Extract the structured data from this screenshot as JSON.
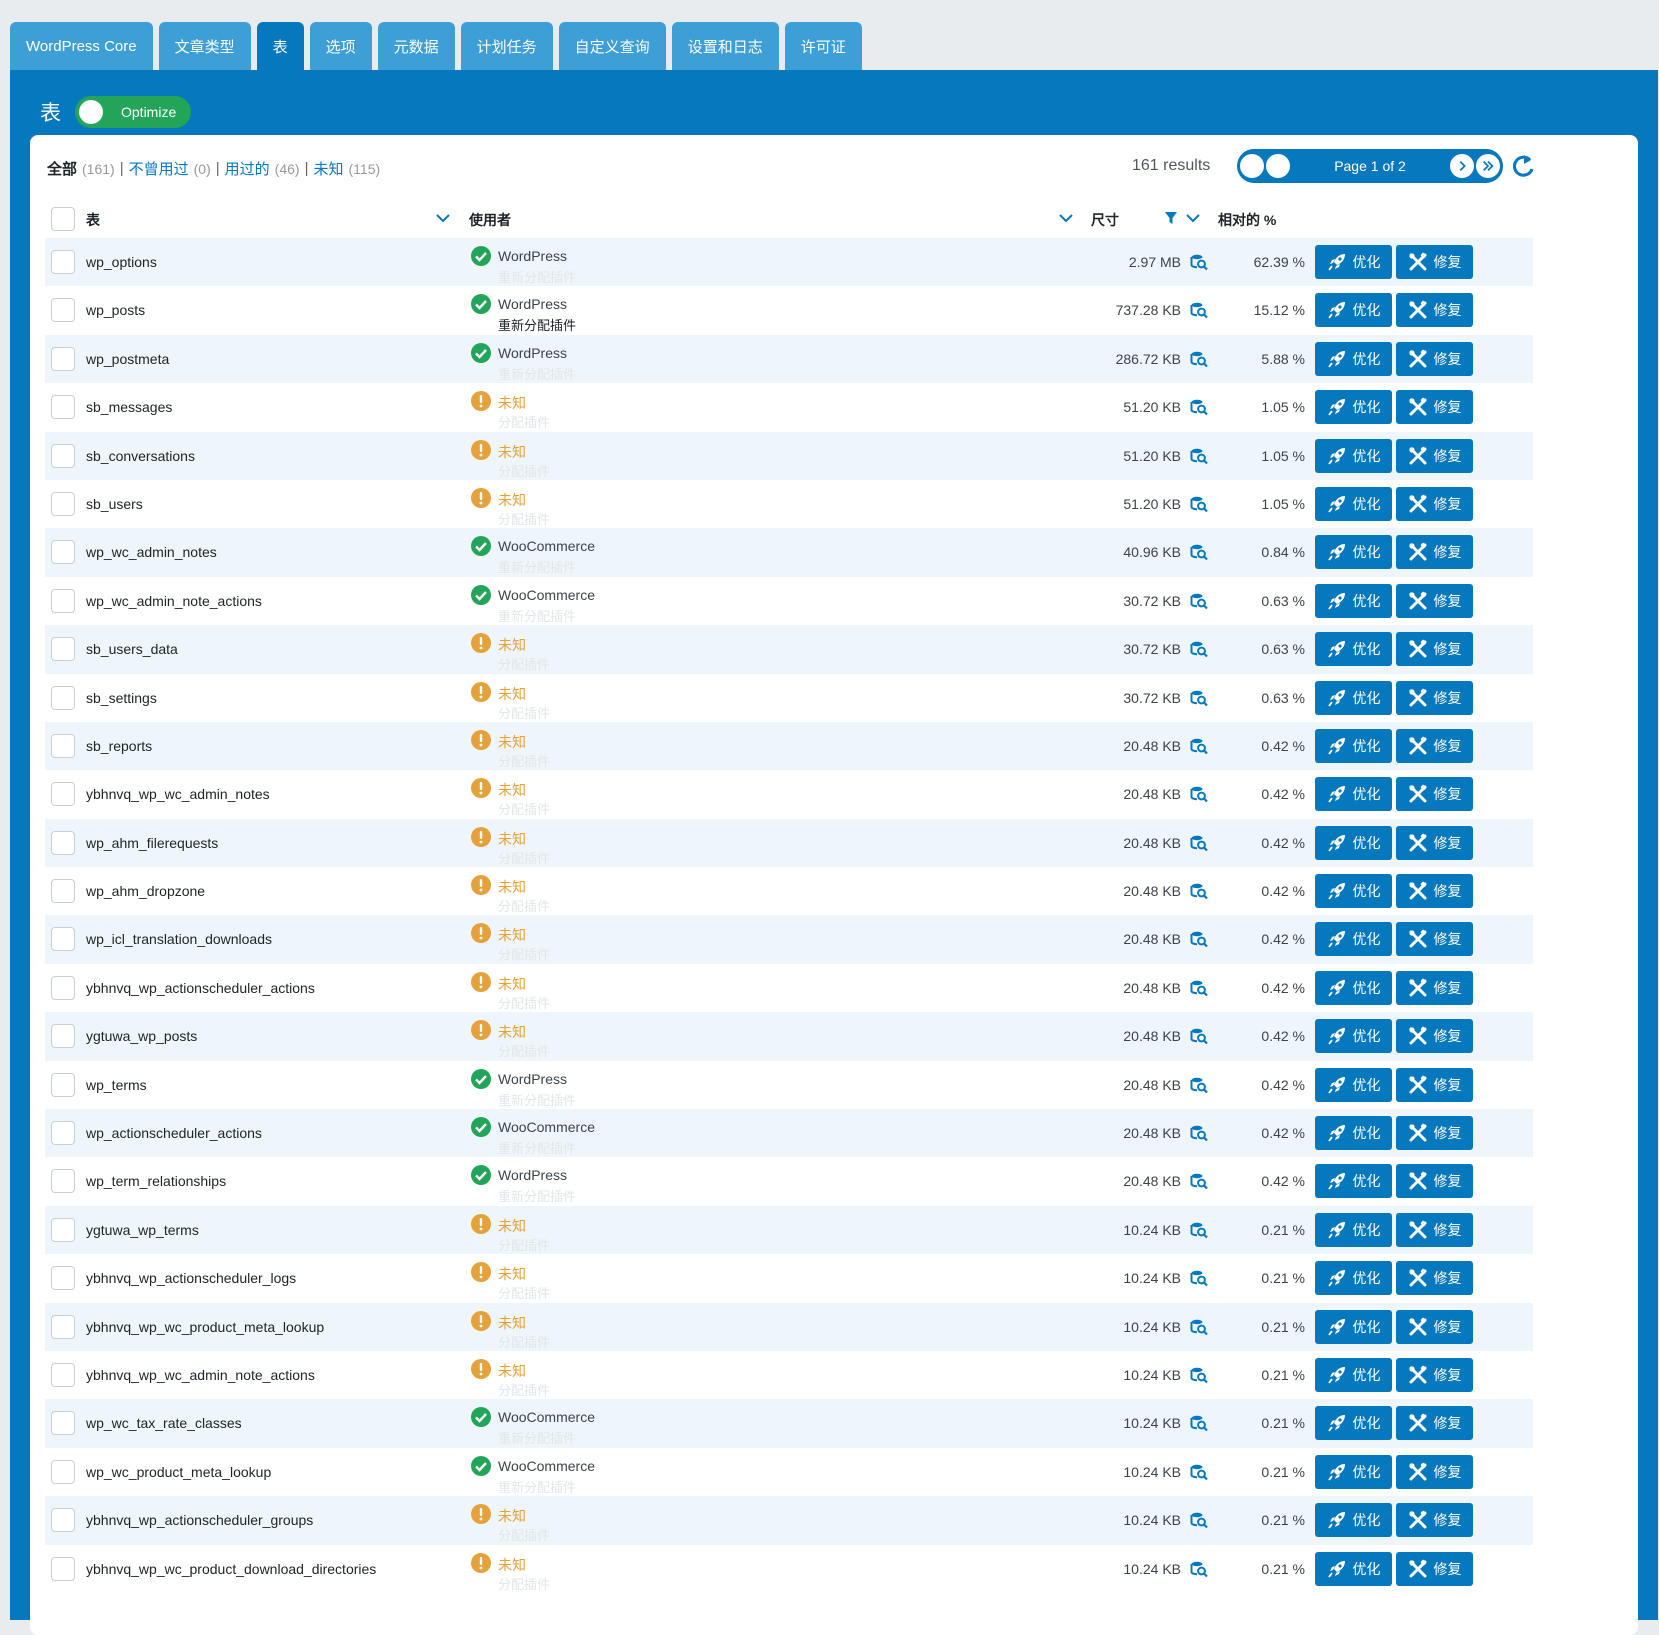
{
  "tabs": [
    "WordPress Core",
    "文章类型",
    "表",
    "选项",
    "元数据",
    "计划任务",
    "自定义查询",
    "设置和日志",
    "许可证"
  ],
  "active_tab": 2,
  "panel": {
    "title": "表",
    "toggle_label": "Optimize"
  },
  "filters": [
    {
      "label": "全部",
      "count": "(161)"
    },
    {
      "label": "不曾用过",
      "count": "(0)"
    },
    {
      "label": "用过的",
      "count": "(46)"
    },
    {
      "label": "未知",
      "count": "(115)"
    }
  ],
  "filter_separator": "|",
  "results": "161 results",
  "pager": {
    "label": "Page 1 of 2"
  },
  "columns": {
    "table": "表",
    "used_by": "使用者",
    "size": "尺寸",
    "relative": "相对的 %"
  },
  "buttons": {
    "optimize": "优化",
    "repair": "修复"
  },
  "colors": {
    "primary": "#0678be",
    "tab": "#3e9fd6",
    "ok": "#22a559",
    "unknown": "#e5a13a"
  },
  "rows": [
    {
      "name": "wp_options",
      "status": "ok",
      "owner": "WordPress",
      "sub": "重新分配插件",
      "sub_visible": false,
      "size": "2.97 MB",
      "pct": "62.39 %"
    },
    {
      "name": "wp_posts",
      "status": "ok",
      "owner": "WordPress",
      "sub": "重新分配插件",
      "sub_visible": true,
      "size": "737.28 KB",
      "pct": "15.12 %"
    },
    {
      "name": "wp_postmeta",
      "status": "ok",
      "owner": "WordPress",
      "sub": "重新分配插件",
      "sub_visible": false,
      "size": "286.72 KB",
      "pct": "5.88 %"
    },
    {
      "name": "sb_messages",
      "status": "unknown",
      "owner": "未知",
      "sub": "分配插件",
      "sub_visible": false,
      "size": "51.20 KB",
      "pct": "1.05 %"
    },
    {
      "name": "sb_conversations",
      "status": "unknown",
      "owner": "未知",
      "sub": "分配插件",
      "sub_visible": false,
      "size": "51.20 KB",
      "pct": "1.05 %"
    },
    {
      "name": "sb_users",
      "status": "unknown",
      "owner": "未知",
      "sub": "分配插件",
      "sub_visible": false,
      "size": "51.20 KB",
      "pct": "1.05 %"
    },
    {
      "name": "wp_wc_admin_notes",
      "status": "ok",
      "owner": "WooCommerce",
      "sub": "重新分配插件",
      "sub_visible": false,
      "size": "40.96 KB",
      "pct": "0.84 %"
    },
    {
      "name": "wp_wc_admin_note_actions",
      "status": "ok",
      "owner": "WooCommerce",
      "sub": "重新分配插件",
      "sub_visible": false,
      "size": "30.72 KB",
      "pct": "0.63 %"
    },
    {
      "name": "sb_users_data",
      "status": "unknown",
      "owner": "未知",
      "sub": "分配插件",
      "sub_visible": false,
      "size": "30.72 KB",
      "pct": "0.63 %"
    },
    {
      "name": "sb_settings",
      "status": "unknown",
      "owner": "未知",
      "sub": "分配插件",
      "sub_visible": false,
      "size": "30.72 KB",
      "pct": "0.63 %"
    },
    {
      "name": "sb_reports",
      "status": "unknown",
      "owner": "未知",
      "sub": "分配插件",
      "sub_visible": false,
      "size": "20.48 KB",
      "pct": "0.42 %"
    },
    {
      "name": "ybhnvq_wp_wc_admin_notes",
      "status": "unknown",
      "owner": "未知",
      "sub": "分配插件",
      "sub_visible": false,
      "size": "20.48 KB",
      "pct": "0.42 %"
    },
    {
      "name": "wp_ahm_filerequests",
      "status": "unknown",
      "owner": "未知",
      "sub": "分配插件",
      "sub_visible": false,
      "size": "20.48 KB",
      "pct": "0.42 %"
    },
    {
      "name": "wp_ahm_dropzone",
      "status": "unknown",
      "owner": "未知",
      "sub": "分配插件",
      "sub_visible": false,
      "size": "20.48 KB",
      "pct": "0.42 %"
    },
    {
      "name": "wp_icl_translation_downloads",
      "status": "unknown",
      "owner": "未知",
      "sub": "分配插件",
      "sub_visible": false,
      "size": "20.48 KB",
      "pct": "0.42 %"
    },
    {
      "name": "ybhnvq_wp_actionscheduler_actions",
      "status": "unknown",
      "owner": "未知",
      "sub": "分配插件",
      "sub_visible": false,
      "size": "20.48 KB",
      "pct": "0.42 %"
    },
    {
      "name": "ygtuwa_wp_posts",
      "status": "unknown",
      "owner": "未知",
      "sub": "分配插件",
      "sub_visible": false,
      "size": "20.48 KB",
      "pct": "0.42 %"
    },
    {
      "name": "wp_terms",
      "status": "ok",
      "owner": "WordPress",
      "sub": "重新分配插件",
      "sub_visible": false,
      "size": "20.48 KB",
      "pct": "0.42 %"
    },
    {
      "name": "wp_actionscheduler_actions",
      "status": "ok",
      "owner": "WooCommerce",
      "sub": "重新分配插件",
      "sub_visible": false,
      "size": "20.48 KB",
      "pct": "0.42 %"
    },
    {
      "name": "wp_term_relationships",
      "status": "ok",
      "owner": "WordPress",
      "sub": "重新分配插件",
      "sub_visible": false,
      "size": "20.48 KB",
      "pct": "0.42 %"
    },
    {
      "name": "ygtuwa_wp_terms",
      "status": "unknown",
      "owner": "未知",
      "sub": "分配插件",
      "sub_visible": false,
      "size": "10.24 KB",
      "pct": "0.21 %"
    },
    {
      "name": "ybhnvq_wp_actionscheduler_logs",
      "status": "unknown",
      "owner": "未知",
      "sub": "分配插件",
      "sub_visible": false,
      "size": "10.24 KB",
      "pct": "0.21 %"
    },
    {
      "name": "ybhnvq_wp_wc_product_meta_lookup",
      "status": "unknown",
      "owner": "未知",
      "sub": "分配插件",
      "sub_visible": false,
      "size": "10.24 KB",
      "pct": "0.21 %"
    },
    {
      "name": "ybhnvq_wp_wc_admin_note_actions",
      "status": "unknown",
      "owner": "未知",
      "sub": "分配插件",
      "sub_visible": false,
      "size": "10.24 KB",
      "pct": "0.21 %"
    },
    {
      "name": "wp_wc_tax_rate_classes",
      "status": "ok",
      "owner": "WooCommerce",
      "sub": "重新分配插件",
      "sub_visible": false,
      "size": "10.24 KB",
      "pct": "0.21 %"
    },
    {
      "name": "wp_wc_product_meta_lookup",
      "status": "ok",
      "owner": "WooCommerce",
      "sub": "重新分配插件",
      "sub_visible": false,
      "size": "10.24 KB",
      "pct": "0.21 %"
    },
    {
      "name": "ybhnvq_wp_actionscheduler_groups",
      "status": "unknown",
      "owner": "未知",
      "sub": "分配插件",
      "sub_visible": false,
      "size": "10.24 KB",
      "pct": "0.21 %"
    },
    {
      "name": "ybhnvq_wp_wc_product_download_directories",
      "status": "unknown",
      "owner": "未知",
      "sub": "分配插件",
      "sub_visible": false,
      "size": "10.24 KB",
      "pct": "0.21 %"
    }
  ]
}
